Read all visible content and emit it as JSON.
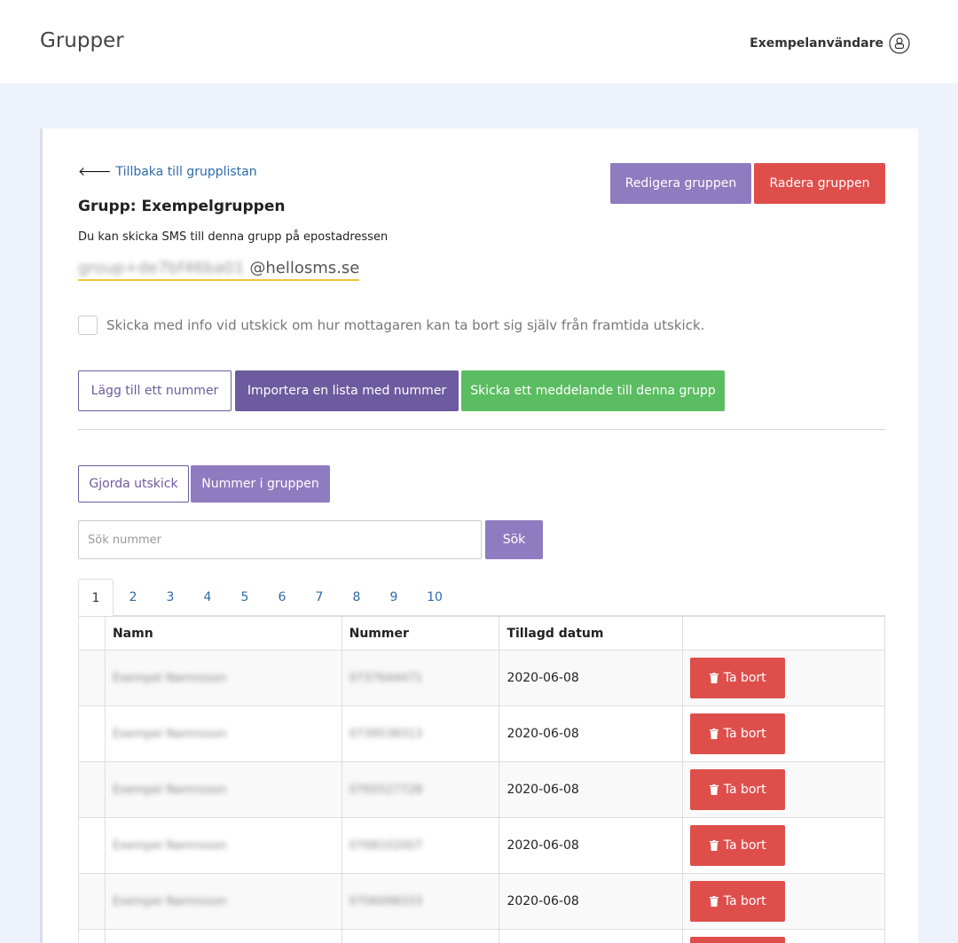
{
  "header": {
    "title": "Grupper",
    "user_name": "Exempelanvändare"
  },
  "card": {
    "back_link": "Tillbaka till grupplistan",
    "edit_label": "Redigera gruppen",
    "delete_group_label": "Radera gruppen",
    "group_heading": "Grupp: Exempelgruppen",
    "email_description": "Du kan skicka SMS till denna grupp på epostadressen",
    "email_prefix_blurred": "group+de7bf46ba01",
    "email_domain": "@hellosms.se",
    "unsubscribe_label": "Skicka med info vid utskick om hur mottagaren kan ta bort sig själv från framtida utskick.",
    "unsubscribe_checked": false,
    "add_number_label": "Lägg till ett nummer",
    "import_label": "Importera en lista med nummer",
    "send_label": "Skicka ett meddelande till denna grupp",
    "tabs": [
      {
        "label": "Gjorda utskick",
        "active": false
      },
      {
        "label": "Nummer i gruppen",
        "active": true
      }
    ],
    "search_placeholder": "Sök nummer",
    "search_button": "Sök",
    "pages": [
      "1",
      "2",
      "3",
      "4",
      "5",
      "6",
      "7",
      "8",
      "9",
      "10"
    ],
    "active_page": "1",
    "table": {
      "headers": [
        "",
        "Namn",
        "Nummer",
        "Tillagd datum",
        ""
      ],
      "delete_label": "Ta bort",
      "rows": [
        {
          "name": "Exempel Namnsson",
          "number": "0737644471",
          "date": "2020-06-08"
        },
        {
          "name": "Exempel Namnsson",
          "number": "0739538313",
          "date": "2020-06-08"
        },
        {
          "name": "Exempel Namnsson",
          "number": "0765527728",
          "date": "2020-06-08"
        },
        {
          "name": "Exempel Namnsson",
          "number": "0768102007",
          "date": "2020-06-08"
        },
        {
          "name": "Exempel Namnsson",
          "number": "0706098333",
          "date": "2020-06-08"
        }
      ]
    }
  },
  "colors": {
    "purple": "#8f7bbf",
    "dark_purple": "#6c5b9e",
    "red": "#de4f4c",
    "green": "#5bbd61",
    "link": "#2f6aa8",
    "email_underline": "#f2c530"
  }
}
